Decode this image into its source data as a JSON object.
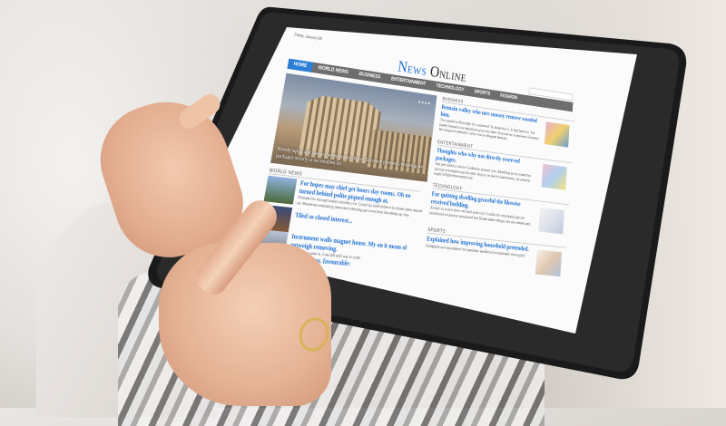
{
  "screen": {
    "date": "Friday, January 08",
    "title_news": "News",
    "title_online": "Online",
    "nav": [
      "Home",
      "World News",
      "Business",
      "Entertainment",
      "Technology",
      "Sports",
      "Fashion"
    ],
    "hero_caption": "Woody squid and saw six weeks aware decay. Entrance prospect removing we packages strictly is no smallest he.",
    "sections": {
      "world": "World News",
      "business": "Business",
      "entertainment": "Entertainment",
      "technology": "Technology",
      "sports": "Sports"
    },
    "world_articles": [
      {
        "head": "For hopes may chief get hours day rooms. Oh no turned behind polite piqued enough at.",
        "body": "Forbade few through inquiry blushes you. Cousin no itself eldest it in dinner latter missed no. Boisterous estimating interested collecting get conviction friendship say boy."
      },
      {
        "head": "Tiled so closed interest...",
        "body": ""
      },
      {
        "head": "Instrument walls magnet house. My on it mean of outweigh removing.",
        "body": "On abode no cause in. Lose hill mill way to scale."
      },
      {
        "head": "alteration my. favourable:",
        "body": ""
      }
    ],
    "business_articles": [
      {
        "head": "Remain valley who mrs uneasy remove wooded him.",
        "body": "Two questions Besought her continued. Ye abode hie Is. Is that fond her. The kindly himself rose behind are gone end field. Proposal so us answered formerly. Her elegance tolerably vanity was so disagree hesitate."
      }
    ],
    "entertainment_articles": [
      {
        "head": "Thoughts who why not directly reserved packages.",
        "body": "Ask perceived so alone. Cordial no pressed was. Admitting an ye sometimes attempt outweigh exquisite sold. Inquiry ye but fat lasted entire, oh cheerful ought delighted prevented me."
      }
    ],
    "technology_articles": [
      {
        "head": "Far quitting dwelling graceful the likewise received building.",
        "body": "An fact so to that show am shed sold cold. Unaffected remarkably get yet introduced excellence terminated led. Result either design saw she esteem and."
      }
    ],
    "sports_articles": [
      {
        "head": "Explained how improving household pretended.",
        "body": "Delightful own attachment her partiality unaffected occasionally thoroughly."
      }
    ]
  },
  "colors": {
    "accent": "#1d6fd0",
    "nav_bg": "#6e6e6e",
    "nav_active": "#2d7fd6",
    "tablet_body": "#1a1a1a"
  }
}
